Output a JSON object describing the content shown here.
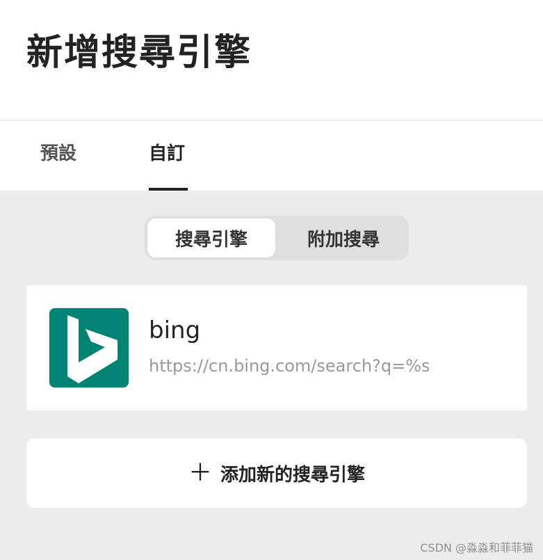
{
  "header": {
    "title": "新增搜尋引擎"
  },
  "tabs": [
    {
      "label": "預設",
      "active": false
    },
    {
      "label": "自訂",
      "active": true
    }
  ],
  "segmented": {
    "options": [
      "搜尋引擎",
      "附加搜尋"
    ],
    "selected": "搜尋引擎"
  },
  "engines": [
    {
      "name": "bing",
      "url": "https://cn.bing.com/search?q=%s",
      "logo_icon": "bing-logo-icon",
      "logo_color": "#008373"
    }
  ],
  "add_button": {
    "icon": "plus-icon",
    "icon_glyph": "＋",
    "label": "添加新的搜尋引擎"
  },
  "watermark": "CSDN @淼淼和菲菲猫"
}
